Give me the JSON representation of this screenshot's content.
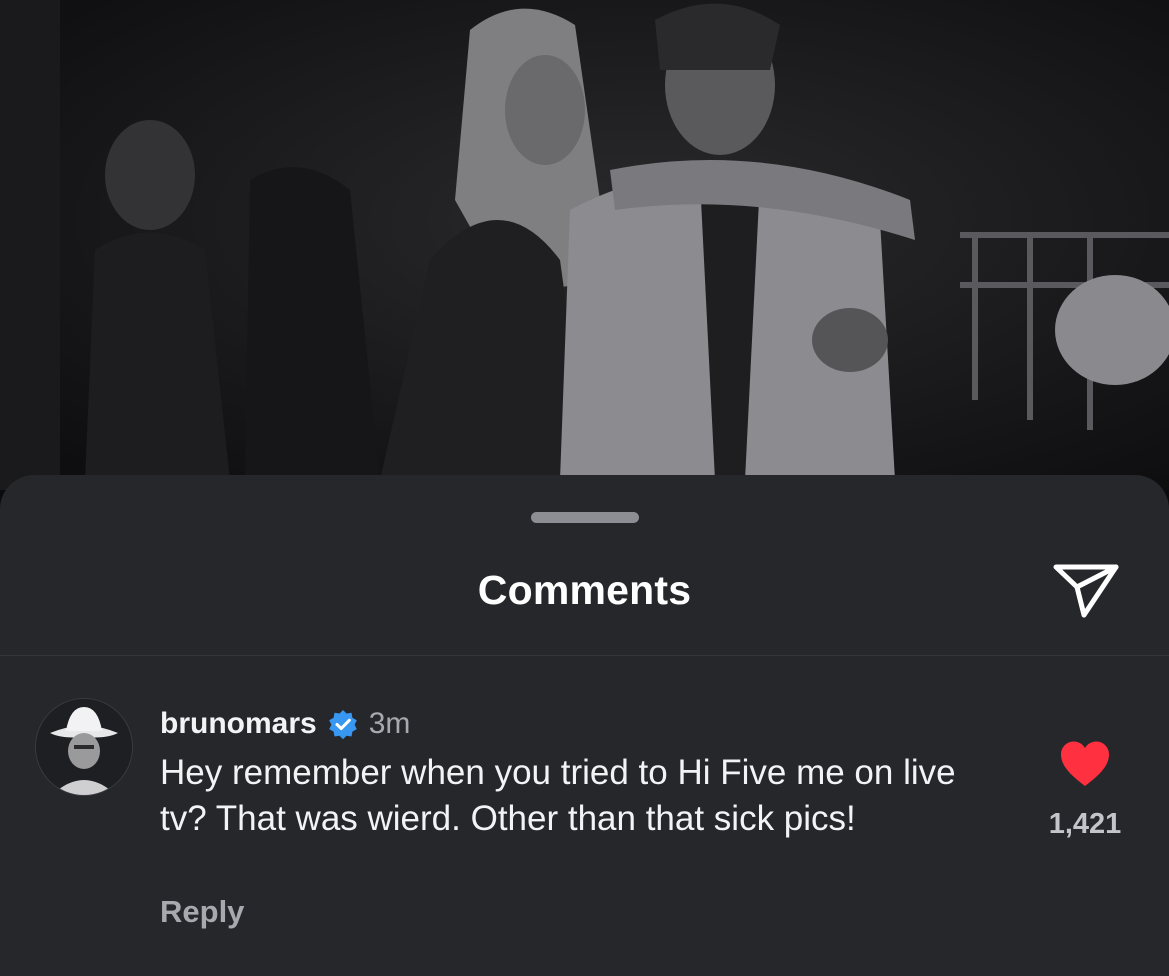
{
  "sheet": {
    "title": "Comments"
  },
  "comment": {
    "username": "brunomars",
    "timestamp": "3m",
    "text": "Hey remember when you tried to Hi Five me on live tv? That was wierd. Other than that sick pics!",
    "reply_label": "Reply",
    "like_count": "1,421",
    "liked": true
  },
  "icons": {
    "share": "paper-plane-icon",
    "verified": "verified-badge-icon",
    "like": "heart-icon"
  },
  "colors": {
    "sheet_background": "#25272b",
    "heart": "#ff3040",
    "verified_badge": "#3897f0",
    "secondary_text": "#a7a9ae"
  }
}
